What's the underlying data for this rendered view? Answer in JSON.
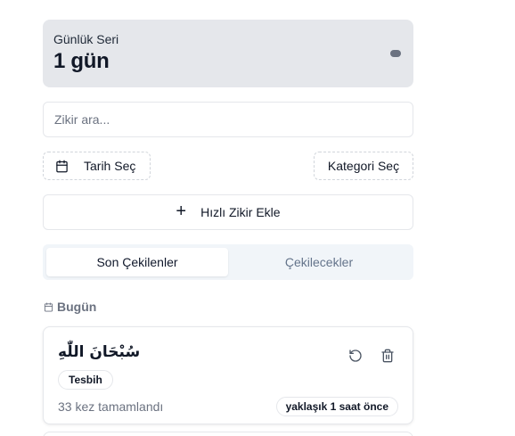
{
  "streak": {
    "label": "Günlük Seri",
    "value": "1 gün"
  },
  "search": {
    "placeholder": "Zikir ara..."
  },
  "filters": {
    "date_label": "Tarih Seç",
    "category_label": "Kategori Seç"
  },
  "quick_add": {
    "label": "Hızlı Zikir Ekle"
  },
  "tabs": [
    {
      "label": "Son Çekilenler",
      "active": true
    },
    {
      "label": "Çekilecekler",
      "active": false
    }
  ],
  "section": {
    "label": "Bugün"
  },
  "items": [
    {
      "arabic": "سُبْحَانَ اللّٰهِ",
      "category": "Tesbih",
      "count_text": "33 kez tamamlandı",
      "time": "yaklaşık 1 saat önce"
    }
  ]
}
